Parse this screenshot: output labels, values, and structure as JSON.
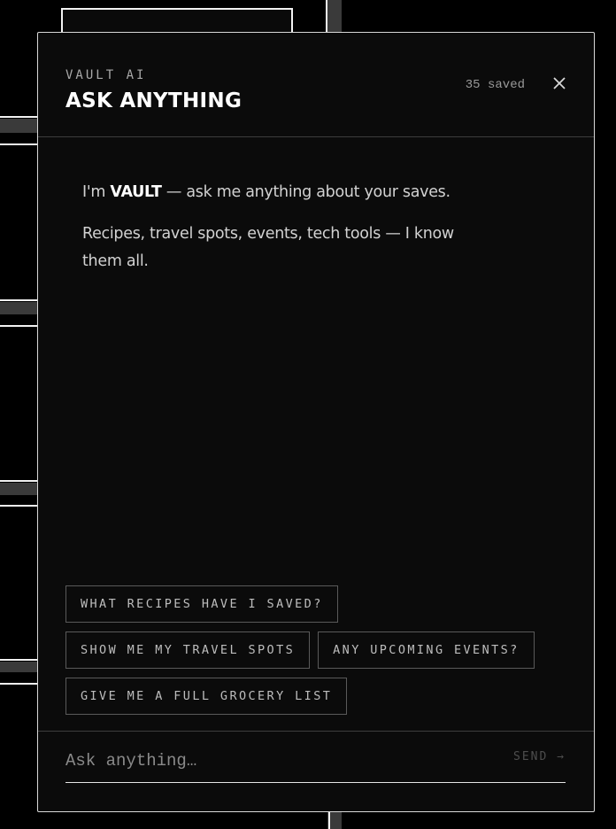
{
  "header": {
    "eyebrow": "VAULT AI",
    "title": "ASK ANYTHING",
    "saved_count": "35 saved",
    "close_icon": "close-icon"
  },
  "messages": {
    "intro_prefix": "I'm ",
    "intro_name": "VAULT",
    "intro_suffix": " — ask me anything about your saves.",
    "second": "Recipes, travel spots, events, tech tools — I know them all."
  },
  "suggestions": {
    "row1": [
      "WHAT RECIPES HAVE I SAVED?"
    ],
    "row2": [
      "SHOW ME MY TRAVEL SPOTS",
      "ANY UPCOMING EVENTS?"
    ],
    "row3": [
      "GIVE ME A FULL GROCERY LIST"
    ]
  },
  "composer": {
    "placeholder": "Ask anything…",
    "send_label": "SEND →"
  },
  "colors": {
    "background": "#000000",
    "panel": "#0b0b0b",
    "border": "#d8d8d8",
    "text_primary": "#ffffff",
    "text_muted": "#a9a9a9"
  }
}
